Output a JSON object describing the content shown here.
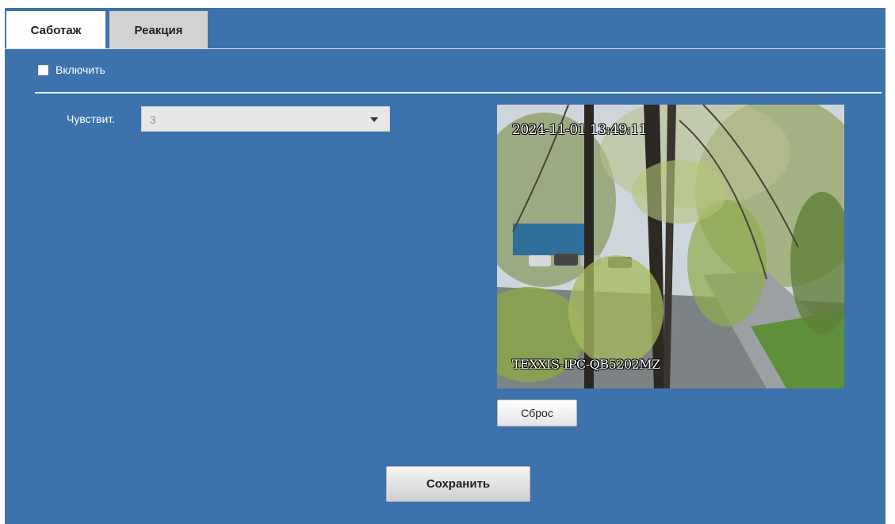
{
  "tabs": [
    {
      "label": "Саботаж",
      "active": true
    },
    {
      "label": "Реакция",
      "active": false
    }
  ],
  "enable": {
    "label": "Включить",
    "checked": false
  },
  "sensitivity": {
    "label": "Чувствит.",
    "value": "3"
  },
  "preview": {
    "timestamp": "2024-11-01 13:49:11",
    "camera_name": "TEXXIS-IPC-QB5202MZ"
  },
  "buttons": {
    "reset_label": "Сброс",
    "save_label": "Сохранить"
  },
  "colors": {
    "panel_bg": "#3e72ad",
    "active_tab": "#ffffff",
    "inactive_tab": "#d2d2d2"
  }
}
